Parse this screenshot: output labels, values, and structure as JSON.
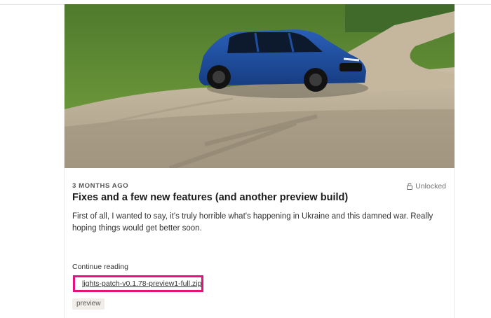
{
  "post": {
    "date": "3 MONTHS AGO",
    "access_status": "Unlocked",
    "title": "Fixes and a few new features (and another preview build)",
    "excerpt": "First of all, I wanted to say, it's truly horrible what's happening in Ukraine and this damned war. Really hoping things would get better soon.",
    "continue_label": "Continue reading",
    "attachment": "lights-patch-v0.1.78-preview1-full.zip",
    "tag": "preview"
  },
  "hero_image": {
    "description_icon": "car-photo",
    "car_color": "#1f4fa3",
    "grass_color": "#6f9a3a",
    "road_color": "#b9ad98"
  },
  "colors": {
    "highlight_border": "#e8107e",
    "tag_background": "#f1eee9"
  }
}
